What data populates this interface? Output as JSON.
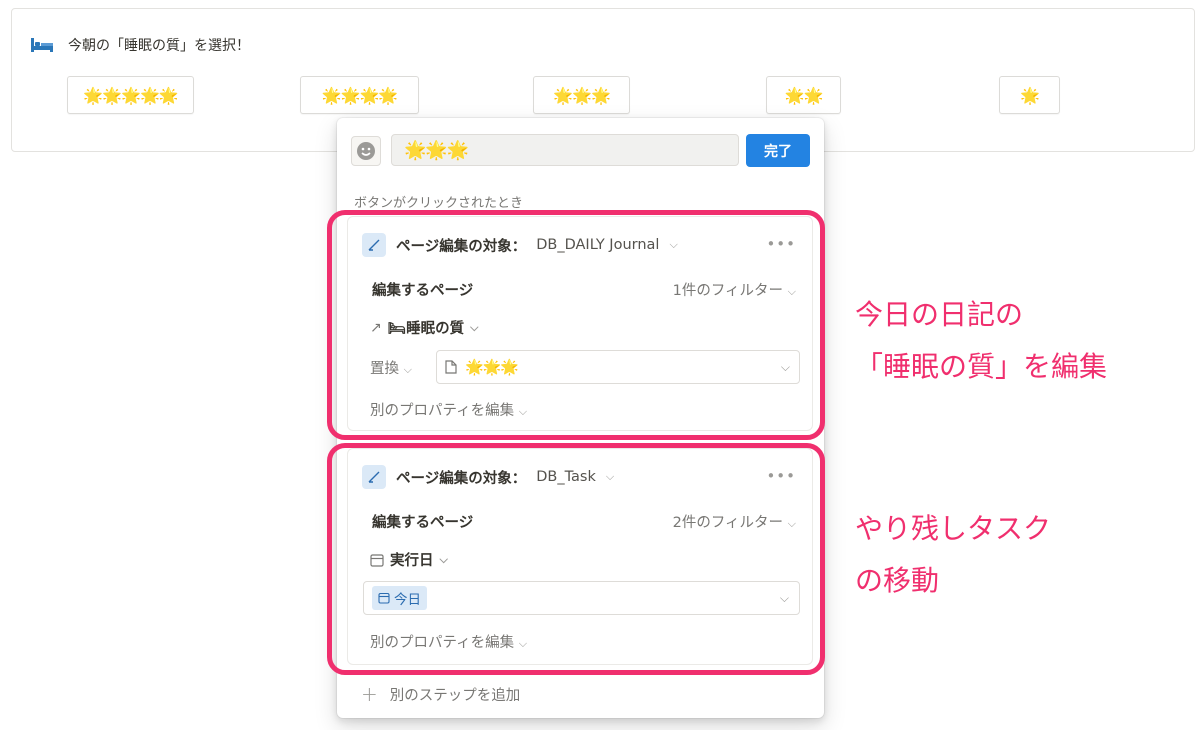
{
  "callout": {
    "icon": "bed-icon",
    "title": "今朝の「睡眠の質」を選択！",
    "buttons": [
      "🌟🌟🌟🌟🌟",
      "🌟🌟🌟🌟",
      "🌟🌟🌟",
      "🌟🌟",
      "🌟"
    ]
  },
  "popup": {
    "emoji_icon": "smiley-icon",
    "name_value": "🌟🌟🌟",
    "done_label": "完了",
    "when_label": "ボタンがクリックされたとき",
    "steps": [
      {
        "head_label": "ページ編集の対象：",
        "head_target": "DB_DAILY Journal",
        "edit_label": "編集するページ",
        "filter": "1件のフィルター",
        "property": "🛏睡眠の質",
        "mode": "置換",
        "value": "🌟🌟🌟",
        "other": "別のプロパティを編集"
      },
      {
        "head_label": "ページ編集の対象：",
        "head_target": "DB_Task",
        "edit_label": "編集するページ",
        "filter": "2件のフィルター",
        "property": "実行日",
        "value": "今日",
        "other": "別のプロパティを編集"
      }
    ],
    "add_step": "別のステップを追加"
  },
  "annotations": {
    "color": "#f02f6e",
    "note1_line1": "今日の日記の",
    "note1_line2": "「睡眠の質」を編集",
    "note2_line1": "やり残しタスク",
    "note2_line2": "の移動"
  }
}
